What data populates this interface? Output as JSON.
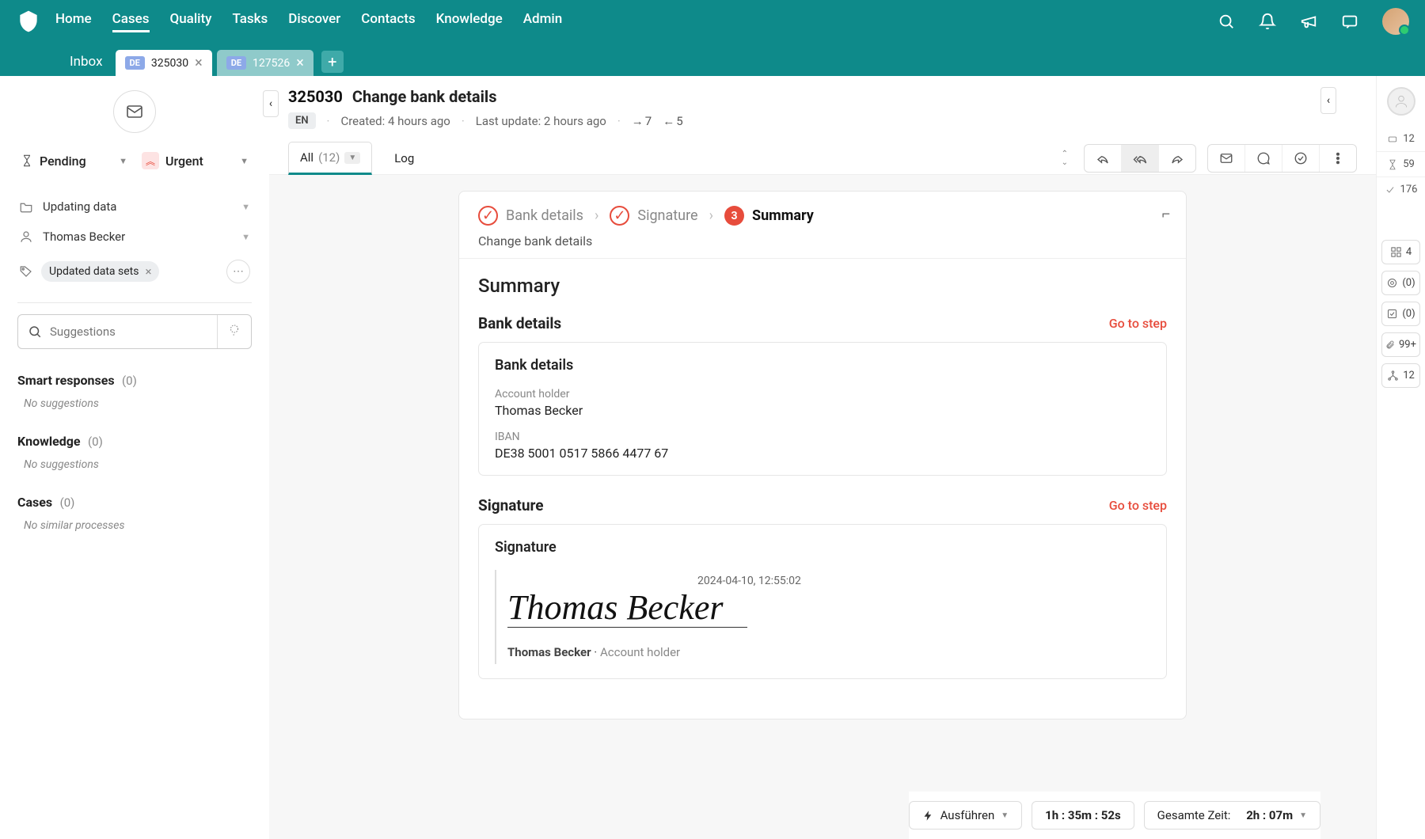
{
  "nav": {
    "items": [
      "Home",
      "Cases",
      "Quality",
      "Tasks",
      "Discover",
      "Contacts",
      "Knowledge",
      "Admin"
    ],
    "active": "Cases"
  },
  "tabs": {
    "inbox": "Inbox",
    "open": [
      {
        "badge": "DE",
        "id": "325030",
        "active": true
      },
      {
        "badge": "DE",
        "id": "127526",
        "active": false
      }
    ]
  },
  "left": {
    "status": "Pending",
    "priority": "Urgent",
    "category": "Updating data",
    "contact": "Thomas Becker",
    "tags": [
      "Updated data sets"
    ],
    "search_placeholder": "Suggestions",
    "sections": {
      "smart": {
        "title": "Smart responses",
        "count": "(0)",
        "empty": "No suggestions"
      },
      "knowledge": {
        "title": "Knowledge",
        "count": "(0)",
        "empty": "No suggestions"
      },
      "cases": {
        "title": "Cases",
        "count": "(0)",
        "empty": "No similar processes"
      }
    }
  },
  "case": {
    "id": "325030",
    "title": "Change bank details",
    "lang": "EN",
    "created": "Created: 4 hours ago",
    "updated": "Last update: 2 hours ago",
    "out": "7",
    "in": "5",
    "all_label": "All",
    "all_count": "(12)",
    "log_label": "Log"
  },
  "process": {
    "steps": [
      "Bank details",
      "Signature",
      "Summary"
    ],
    "current_num": "3",
    "subtitle": "Change bank details",
    "summary_title": "Summary",
    "bank": {
      "section": "Bank details",
      "goto": "Go to step",
      "card_title": "Bank details",
      "holder_label": "Account holder",
      "holder": "Thomas Becker",
      "iban_label": "IBAN",
      "iban": "DE38 5001 0517 5866 4477 67"
    },
    "sig": {
      "section": "Signature",
      "goto": "Go to step",
      "card_title": "Signature",
      "timestamp": "2024-04-10, 12:55:02",
      "name": "Thomas Becker",
      "meta_name": "Thomas Becker",
      "meta_role": "Account holder"
    }
  },
  "rail": {
    "stat1": "12",
    "stat2": "59",
    "stat3": "176",
    "b1": "4",
    "b2": "(0)",
    "b3": "(0)",
    "b4": "99+",
    "b5": "12"
  },
  "footer": {
    "execute": "Ausführen",
    "timer": "1h : 35m : 52s",
    "total_label": "Gesamte Zeit:",
    "total": "2h : 07m"
  }
}
